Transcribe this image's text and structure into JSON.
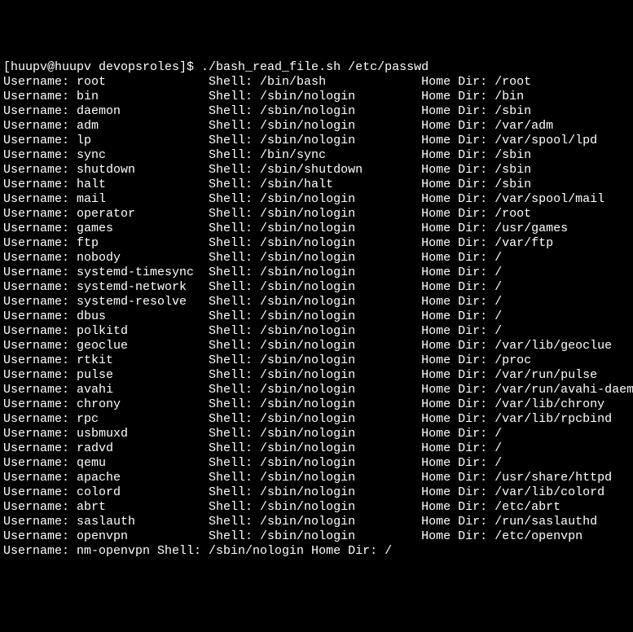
{
  "prompt": {
    "user": "huupv",
    "host": "huupv",
    "dir": "devopsroles",
    "symbol": "$",
    "command": "./bash_read_file.sh /etc/passwd"
  },
  "entries": [
    {
      "username": "root",
      "shell": "/bin/bash",
      "home": "/root"
    },
    {
      "username": "bin",
      "shell": "/sbin/nologin",
      "home": "/bin"
    },
    {
      "username": "daemon",
      "shell": "/sbin/nologin",
      "home": "/sbin"
    },
    {
      "username": "adm",
      "shell": "/sbin/nologin",
      "home": "/var/adm"
    },
    {
      "username": "lp",
      "shell": "/sbin/nologin",
      "home": "/var/spool/lpd"
    },
    {
      "username": "sync",
      "shell": "/bin/sync",
      "home": "/sbin"
    },
    {
      "username": "shutdown",
      "shell": "/sbin/shutdown",
      "home": "/sbin"
    },
    {
      "username": "halt",
      "shell": "/sbin/halt",
      "home": "/sbin"
    },
    {
      "username": "mail",
      "shell": "/sbin/nologin",
      "home": "/var/spool/mail"
    },
    {
      "username": "operator",
      "shell": "/sbin/nologin",
      "home": "/root"
    },
    {
      "username": "games",
      "shell": "/sbin/nologin",
      "home": "/usr/games"
    },
    {
      "username": "ftp",
      "shell": "/sbin/nologin",
      "home": "/var/ftp"
    },
    {
      "username": "nobody",
      "shell": "/sbin/nologin",
      "home": "/"
    },
    {
      "username": "systemd-timesync",
      "shell": "/sbin/nologin",
      "home": "/"
    },
    {
      "username": "systemd-network",
      "shell": "/sbin/nologin",
      "home": "/"
    },
    {
      "username": "systemd-resolve",
      "shell": "/sbin/nologin",
      "home": "/"
    },
    {
      "username": "dbus",
      "shell": "/sbin/nologin",
      "home": "/"
    },
    {
      "username": "polkitd",
      "shell": "/sbin/nologin",
      "home": "/"
    },
    {
      "username": "geoclue",
      "shell": "/sbin/nologin",
      "home": "/var/lib/geoclue"
    },
    {
      "username": "rtkit",
      "shell": "/sbin/nologin",
      "home": "/proc"
    },
    {
      "username": "pulse",
      "shell": "/sbin/nologin",
      "home": "/var/run/pulse"
    },
    {
      "username": "avahi",
      "shell": "/sbin/nologin",
      "home": "/var/run/avahi-daemon"
    },
    {
      "username": "chrony",
      "shell": "/sbin/nologin",
      "home": "/var/lib/chrony"
    },
    {
      "username": "rpc",
      "shell": "/sbin/nologin",
      "home": "/var/lib/rpcbind"
    },
    {
      "username": "usbmuxd",
      "shell": "/sbin/nologin",
      "home": "/"
    },
    {
      "username": "radvd",
      "shell": "/sbin/nologin",
      "home": "/"
    },
    {
      "username": "qemu",
      "shell": "/sbin/nologin",
      "home": "/"
    },
    {
      "username": "apache",
      "shell": "/sbin/nologin",
      "home": "/usr/share/httpd"
    },
    {
      "username": "colord",
      "shell": "/sbin/nologin",
      "home": "/var/lib/colord"
    },
    {
      "username": "abrt",
      "shell": "/sbin/nologin",
      "home": "/etc/abrt"
    },
    {
      "username": "saslauth",
      "shell": "/sbin/nologin",
      "home": "/run/saslauthd"
    },
    {
      "username": "openvpn",
      "shell": "/sbin/nologin",
      "home": "/etc/openvpn"
    },
    {
      "username": "nm-openvpn",
      "shell": "/sbin/nologin",
      "home": "/"
    }
  ],
  "labels": {
    "username": "Username:",
    "shell": "Shell:",
    "home": "Home Dir:"
  },
  "col_widths": {
    "username": 18,
    "shell": 22
  }
}
